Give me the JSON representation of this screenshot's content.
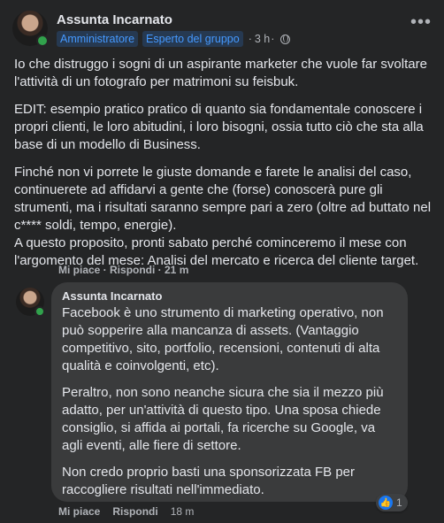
{
  "post": {
    "author": "Assunta Incarnato",
    "badges": [
      "Amministratore",
      "Esperto del gruppo"
    ],
    "time": "3 h",
    "separator": "·",
    "more_label": "•••",
    "paragraphs": [
      "Io che distruggo i sogni di un aspirante marketer che vuole far svoltare l'attività di un fotografo per matrimoni su feisbuk.",
      "EDIT: esempio pratico pratico di quanto sia fondamentale conoscere i propri clienti, le loro abitudini, i loro bisogni, ossia tutto ciò che sta alla base di un modello di Business.",
      "Finché non vi porrete le giuste domande e farete le analisi del caso, continuerete ad affidarvi a gente che (forse) conoscerà pure gli strumenti, ma i risultati saranno sempre pari a zero (oltre ad buttato nel c**** soldi, tempo, energie).\nA questo proposito, pronti sabato perché cominceremo il mese con l'argomento del mese: Analisi del mercato e ricerca del cliente target."
    ],
    "hidden_actions": "Mi piace · Rispondi · 21 m"
  },
  "comment": {
    "author": "Assunta Incarnato",
    "paragraphs": [
      "Facebook è uno strumento di marketing operativo, non può sopperire alla mancanza di assets. (Vantaggio competitivo, sito, portfolio, recensioni, contenuti di alta qualità e coinvolgenti, etc).",
      "Peraltro, non sono neanche sicura che sia il mezzo più adatto, per un'attività di questo tipo. Una sposa chiede consiglio, si affida ai portali, fa ricerche su Google, va agli eventi, alle fiere di settore.",
      "Non credo proprio basti una sponsorizzata FB per raccogliere risultati nell'immediato."
    ],
    "like_label": "Mi piace",
    "reply_label": "Rispondi",
    "time": "18 m",
    "reaction_count": "1",
    "reaction_icon": "thumbs-up-icon"
  },
  "colors": {
    "background": "#242526",
    "bubble": "#3a3b3c",
    "badge_text": "#4599ff",
    "like_blue": "#1877f2",
    "online": "#31a24c"
  }
}
